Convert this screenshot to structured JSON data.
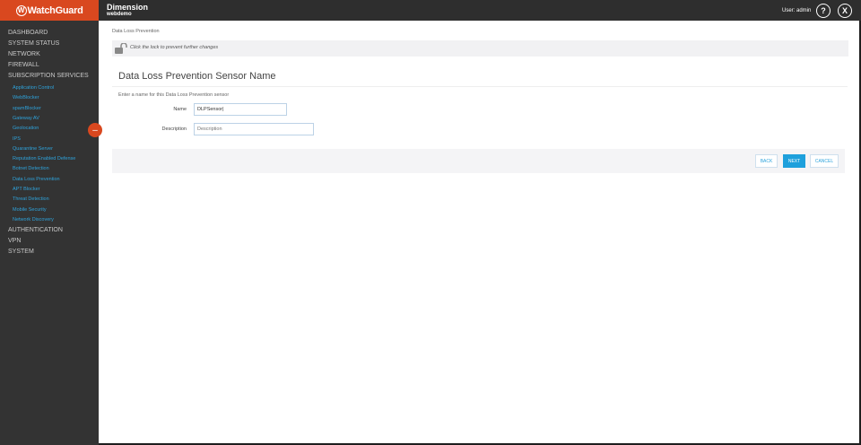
{
  "header": {
    "logo": "WatchGuard",
    "title": "Dimension",
    "subtitle": "webdemo",
    "user": "User: admin",
    "help_icon": "?",
    "close_icon": "X"
  },
  "sidebar": {
    "items": [
      {
        "label": "DASHBOARD"
      },
      {
        "label": "SYSTEM STATUS"
      },
      {
        "label": "NETWORK"
      },
      {
        "label": "FIREWALL"
      },
      {
        "label": "SUBSCRIPTION SERVICES"
      }
    ],
    "subitems": [
      {
        "label": "Application Control"
      },
      {
        "label": "WebBlocker"
      },
      {
        "label": "spamBlocker"
      },
      {
        "label": "Gateway AV"
      },
      {
        "label": "Geolocation"
      },
      {
        "label": "IPS"
      },
      {
        "label": "Quarantine Server"
      },
      {
        "label": "Reputation Enabled Defense"
      },
      {
        "label": "Botnet Detection"
      },
      {
        "label": "Data Loss Prevention"
      },
      {
        "label": "APT Blocker"
      },
      {
        "label": "Threat Detection"
      },
      {
        "label": "Mobile Security"
      },
      {
        "label": "Network Discovery"
      }
    ],
    "bottom": [
      {
        "label": "AUTHENTICATION"
      },
      {
        "label": "VPN"
      },
      {
        "label": "SYSTEM"
      }
    ],
    "collapse": "–"
  },
  "main": {
    "breadcrumb": "Data Loss Prevention",
    "lock_text": "Click the lock to prevent further changes",
    "heading": "Data Loss Prevention Sensor Name",
    "instructions": "Enter a name for this Data Loss Prevention sensor",
    "name_label": "Name",
    "name_value": "DLPSensor|",
    "description_label": "Description",
    "description_placeholder": "Description",
    "buttons": {
      "back": "BACK",
      "next": "NEXT",
      "cancel": "CANCEL"
    }
  },
  "colors": {
    "brand": "#d9481f",
    "accent": "#1ea0dc"
  }
}
